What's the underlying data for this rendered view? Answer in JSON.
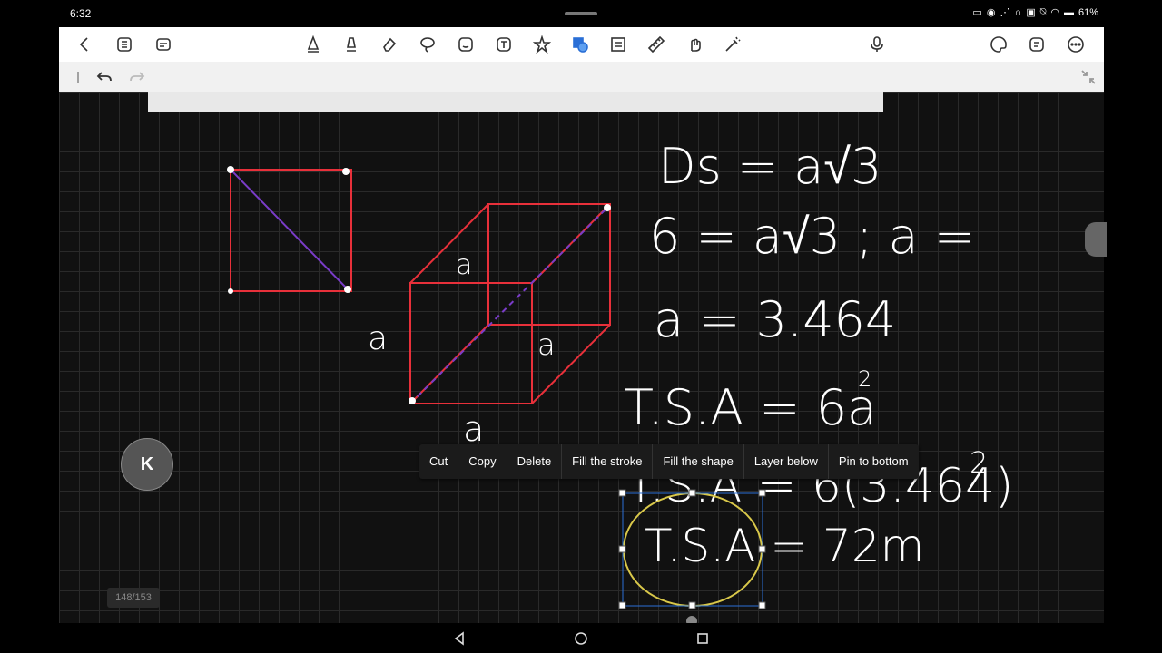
{
  "status": {
    "time": "6:32",
    "battery": "61%"
  },
  "toolbar": {
    "icons": [
      "back-icon",
      "grid-icon",
      "menu-icon",
      "pen-icon",
      "highlighter-icon",
      "eraser-icon",
      "lasso-icon",
      "shapes-icon",
      "text-icon",
      "star-icon",
      "image-icon",
      "table-icon",
      "ruler-icon",
      "hand-icon",
      "laser-icon",
      "mic-icon",
      "palette-icon",
      "edit-icon",
      "more-icon"
    ]
  },
  "subbar": {
    "undo": "undo-icon",
    "redo": "redo-icon",
    "collapse": "collapse-icon"
  },
  "canvas": {
    "cube_labels": [
      "a",
      "a",
      "a",
      "a"
    ],
    "eq1": "Ds = a√3",
    "eq2": "6 = a√3 ; a =",
    "eq3": "a = 3.464",
    "eq4": "T.S.A = 6a",
    "eq4_exp": "2",
    "eq5": "T.S.A = 6(3.464)",
    "eq5_exp": "2",
    "eq6": "T.S.A = 72m",
    "colors": {
      "cube_edges": "#e8303a",
      "diagonal": "#7a3cc8",
      "selection_ellipse": "#d9c84a",
      "selection_box": "#2a6fd6"
    }
  },
  "context_menu": {
    "items": [
      "Cut",
      "Copy",
      "Delete",
      "Fill the stroke",
      "Fill the shape",
      "Layer below",
      "Pin to bottom"
    ]
  },
  "floating": {
    "k_button": "K",
    "page_counter": "148/153"
  }
}
